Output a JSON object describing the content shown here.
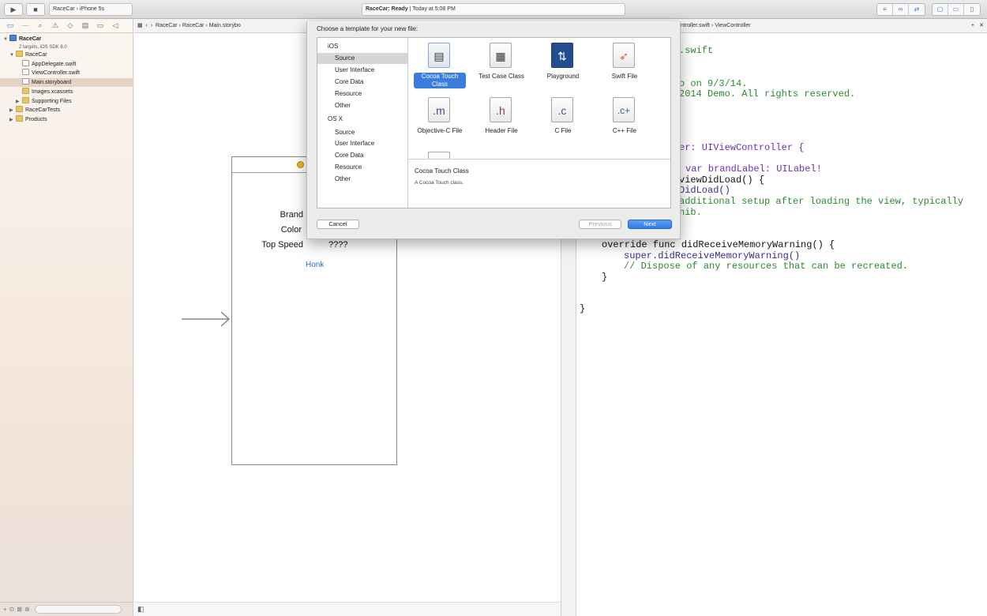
{
  "toolbar": {
    "run_label": "▶",
    "stop_label": "■",
    "scheme": "RaceCar",
    "destination": "iPhone 5s",
    "status_title": "RaceCar: Ready",
    "status_time": "Today at 5:08 PM",
    "editor_icons": [
      "≡",
      "∞",
      "⇄"
    ],
    "view_icons": [
      "▢",
      "▭",
      "▯"
    ]
  },
  "navigator": {
    "tab_icons": [
      "▭",
      "⋯",
      "⌕",
      "⚠",
      "◇",
      "▤",
      "▭",
      "◁"
    ],
    "items": [
      {
        "label": "RaceCar",
        "sub": "2 targets, iOS SDK 8.0",
        "kind": "project"
      },
      {
        "label": "RaceCar",
        "kind": "folder"
      },
      {
        "label": "AppDelegate.swift",
        "kind": "file"
      },
      {
        "label": "ViewController.swift",
        "kind": "file"
      },
      {
        "label": "Main.storyboard",
        "kind": "file"
      },
      {
        "label": "Images.xcassets",
        "kind": "folder"
      },
      {
        "label": "Supporting Files",
        "kind": "folder"
      },
      {
        "label": "RaceCarTests",
        "kind": "folder"
      },
      {
        "label": "Products",
        "kind": "folder"
      }
    ],
    "filter_icons": [
      "+",
      "⊙",
      "⊠",
      "⊛"
    ]
  },
  "jumpbar_left": {
    "items": [
      "RaceCar",
      "RaceCar",
      "Main.storybo"
    ]
  },
  "jumpbar_right": {
    "items": [
      "ntroller.swift",
      "ViewController"
    ],
    "add_icon": "+",
    "close_icon": "✕"
  },
  "canvas": {
    "labels": [
      "Brand",
      "Color",
      "Top Speed"
    ],
    "speed_value": "????",
    "honk_button": "Honk",
    "bottom_icon": "◧"
  },
  "editor": {
    "lines": [
      ".swift",
      "o on 9/3/14.",
      "2014 Demo. All rights reserved.",
      "er: UIViewController {",
      "var brandLabel: UILabel!",
      "viewDidLoad() {",
      "DidLoad()",
      "additional setup after loading the view, typically",
      "nib.",
      "override func didReceiveMemoryWarning() {",
      "super.didReceiveMemoryWarning()",
      "// Dispose of any resources that can be recreated.",
      "}",
      "}"
    ]
  },
  "dialog": {
    "title": "Choose a template for your new file:",
    "categories": [
      {
        "label": "iOS",
        "header": true
      },
      {
        "label": "Source"
      },
      {
        "label": "User Interface"
      },
      {
        "label": "Core Data"
      },
      {
        "label": "Resource"
      },
      {
        "label": "Other"
      },
      {
        "label": "OS X",
        "header": true
      },
      {
        "label": "Source"
      },
      {
        "label": "User Interface"
      },
      {
        "label": "Core Data"
      },
      {
        "label": "Resource"
      },
      {
        "label": "Other"
      }
    ],
    "templates": [
      {
        "name": "Cocoa Touch Class",
        "glyph": "▤"
      },
      {
        "name": "Test Case Class",
        "glyph": "▦"
      },
      {
        "name": "Playground",
        "glyph": "⇅"
      },
      {
        "name": "Swift File",
        "glyph": "➶"
      },
      {
        "name": "Objective-C File",
        "glyph": ".m"
      },
      {
        "name": "Header File",
        "glyph": ".h"
      },
      {
        "name": "C File",
        "glyph": ".c"
      },
      {
        "name": "C++ File",
        "glyph": ".c+"
      }
    ],
    "selected_template": "Cocoa Touch Class",
    "description_title": "Cocoa Touch Class",
    "description_text": "A Cocoa Touch class.",
    "cancel_label": "Cancel",
    "previous_label": "Previous",
    "next_label": "Next"
  },
  "colors": {
    "accent": "#3b7ddd",
    "keyword": "#b0208f",
    "type": "#6c2fb2",
    "comment": "#2d8a2d"
  }
}
